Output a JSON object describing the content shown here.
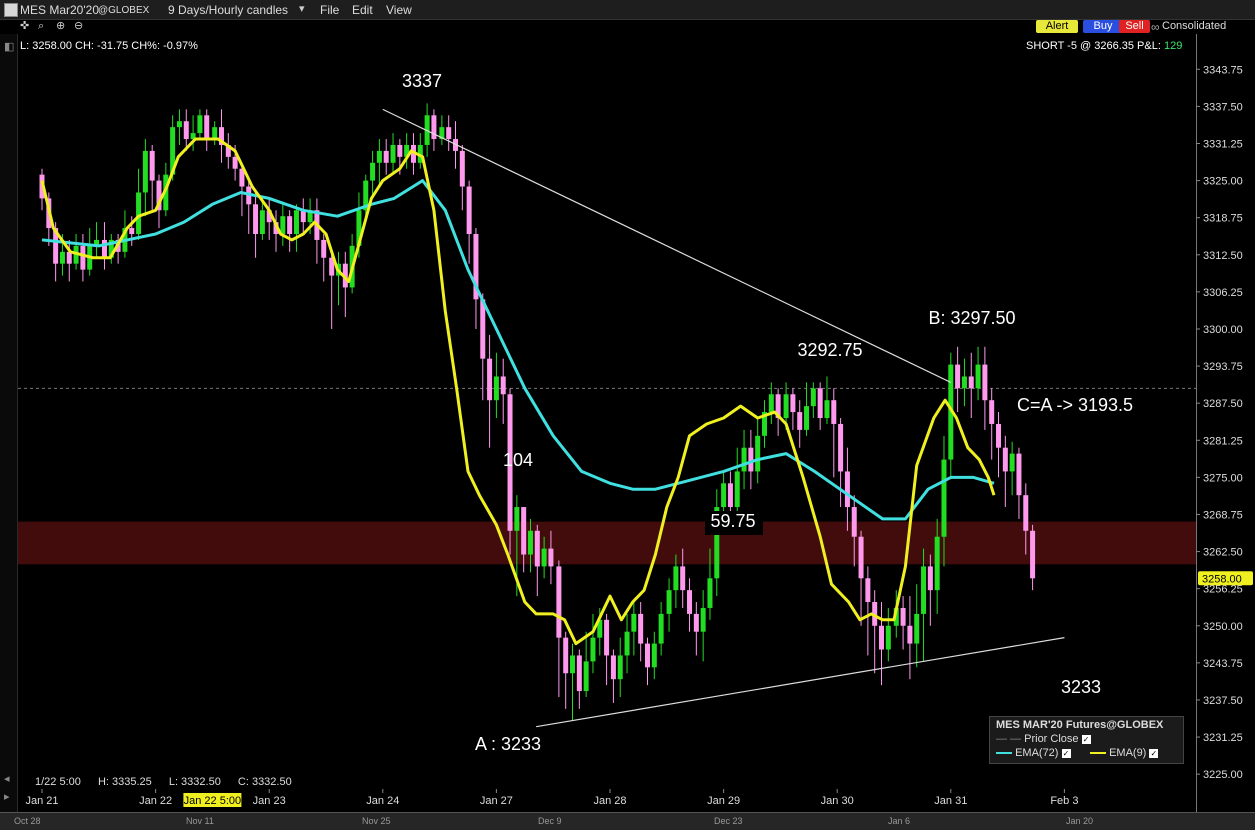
{
  "window": {
    "symbol": "MES Mar20'20",
    "exchange": "@GLOBEX",
    "timeframe": "9 Days/Hourly candles",
    "menu": [
      "File",
      "Edit",
      "View"
    ]
  },
  "toolbar": {
    "alert_label": "Alert",
    "buy_label": "Buy",
    "sell_label": "Sell",
    "consolidated_label": "Consolidated"
  },
  "info": {
    "last_line": "L: 3258.00 CH: -31.75 CH%: -0.97%",
    "position_line": "SHORT -5 @ 3266.35 P&L:",
    "pnl_value": "129"
  },
  "status": {
    "date": "1/22 5:00",
    "high": "H: 3335.25",
    "low": "L: 3332.50",
    "close": "C: 3332.50"
  },
  "legend": {
    "title": "MES MAR'20 Futures@GLOBEX",
    "prior_close": "Prior Close",
    "ema_slow": "EMA(72)",
    "ema_fast": "EMA(9)"
  },
  "overview_labels": [
    "Oct 28",
    "Nov 11",
    "Nov 25",
    "Dec 9",
    "Dec 23",
    "Jan 6",
    "Jan 20"
  ],
  "colors": {
    "up_candle": "#22dd22",
    "down_candle": "#ff99ee",
    "ema_fast": "#f0f020",
    "ema_slow": "#40e0e0",
    "price_tag": "#f0f020",
    "loss_band": "#5a1010"
  },
  "chart_data": {
    "type": "candlestick",
    "y_ticks": [
      "3343.75",
      "3337.50",
      "3331.25",
      "3325.00",
      "3318.75",
      "3312.50",
      "3306.25",
      "3300.00",
      "3293.75",
      "3287.50",
      "3281.25",
      "3275.00",
      "3268.75",
      "3262.50",
      "3256.25",
      "3250.00",
      "3243.75",
      "3237.50",
      "3231.25",
      "3225.00"
    ],
    "ylim": [
      3222.5,
      3347
    ],
    "x_labels": [
      "Jan 21",
      "Jan 22",
      "Jan 23",
      "Jan 24",
      "Jan 27",
      "Jan 28",
      "Jan 29",
      "Jan 30",
      "Jan 31",
      "Feb 3"
    ],
    "x_label_highlight": "Jan 22 5:00",
    "last_price": "3258.00",
    "prior_close": 3290,
    "position_price": 3266.35,
    "ema_labels": [
      "EMA(72)",
      "EMA(9)"
    ],
    "annotations": [
      "3337",
      "104",
      "59.75",
      "3292.75",
      "B: 3297.50",
      "C=A  -> 3193.5",
      "3233",
      "A : 3233"
    ],
    "trendlines": [
      {
        "from": [
          3.0,
          3337
        ],
        "to": [
          8.0,
          3291
        ]
      },
      {
        "from": [
          4.35,
          3233
        ],
        "to": [
          9.0,
          3248
        ]
      }
    ],
    "ema_fast": [
      [
        0.0,
        3325
      ],
      [
        0.1,
        3317
      ],
      [
        0.25,
        3313
      ],
      [
        0.45,
        3312
      ],
      [
        0.6,
        3312
      ],
      [
        0.75,
        3317
      ],
      [
        0.85,
        3319
      ],
      [
        1.0,
        3320
      ],
      [
        1.1,
        3324
      ],
      [
        1.2,
        3329
      ],
      [
        1.35,
        3332
      ],
      [
        1.55,
        3332
      ],
      [
        1.7,
        3330
      ],
      [
        1.85,
        3324
      ],
      [
        2.0,
        3320
      ],
      [
        2.1,
        3316
      ],
      [
        2.2,
        3315
      ],
      [
        2.3,
        3316
      ],
      [
        2.4,
        3318
      ],
      [
        2.5,
        3316
      ],
      [
        2.6,
        3310
      ],
      [
        2.7,
        3308
      ],
      [
        2.8,
        3315
      ],
      [
        2.9,
        3322
      ],
      [
        3.0,
        3325
      ],
      [
        3.15,
        3327
      ],
      [
        3.25,
        3330
      ],
      [
        3.35,
        3329
      ],
      [
        3.45,
        3320
      ],
      [
        3.55,
        3303
      ],
      [
        3.65,
        3290
      ],
      [
        3.75,
        3276
      ],
      [
        3.85,
        3272
      ],
      [
        4.0,
        3267
      ],
      [
        4.1,
        3262
      ],
      [
        4.25,
        3254
      ],
      [
        4.35,
        3252
      ],
      [
        4.5,
        3252
      ],
      [
        4.6,
        3251
      ],
      [
        4.7,
        3247
      ],
      [
        4.85,
        3249
      ],
      [
        5.0,
        3255
      ],
      [
        5.1,
        3251
      ],
      [
        5.2,
        3254
      ],
      [
        5.3,
        3256
      ],
      [
        5.4,
        3262
      ],
      [
        5.5,
        3270
      ],
      [
        5.6,
        3275
      ],
      [
        5.7,
        3282
      ],
      [
        5.85,
        3284
      ],
      [
        6.0,
        3285
      ],
      [
        6.15,
        3287
      ],
      [
        6.3,
        3285
      ],
      [
        6.45,
        3286
      ],
      [
        6.55,
        3284
      ],
      [
        6.7,
        3275
      ],
      [
        6.85,
        3265
      ],
      [
        6.95,
        3257
      ],
      [
        7.1,
        3254
      ],
      [
        7.2,
        3251
      ],
      [
        7.3,
        3252
      ],
      [
        7.4,
        3251
      ],
      [
        7.5,
        3251
      ],
      [
        7.6,
        3260
      ],
      [
        7.7,
        3277
      ],
      [
        7.85,
        3285
      ],
      [
        7.95,
        3288
      ],
      [
        8.05,
        3285
      ],
      [
        8.15,
        3280
      ],
      [
        8.25,
        3278
      ],
      [
        8.33,
        3275
      ],
      [
        8.38,
        3272
      ]
    ],
    "ema_slow": [
      [
        0.0,
        3315
      ],
      [
        0.5,
        3314
      ],
      [
        1.0,
        3316
      ],
      [
        1.25,
        3318
      ],
      [
        1.5,
        3321
      ],
      [
        1.75,
        3323
      ],
      [
        2.0,
        3322
      ],
      [
        2.3,
        3320
      ],
      [
        2.6,
        3319
      ],
      [
        2.9,
        3321
      ],
      [
        3.1,
        3322
      ],
      [
        3.35,
        3325
      ],
      [
        3.55,
        3320
      ],
      [
        3.75,
        3310
      ],
      [
        4.0,
        3300
      ],
      [
        4.25,
        3290
      ],
      [
        4.5,
        3282
      ],
      [
        4.75,
        3276
      ],
      [
        5.0,
        3274
      ],
      [
        5.2,
        3273
      ],
      [
        5.4,
        3273
      ],
      [
        5.6,
        3274
      ],
      [
        6.0,
        3276
      ],
      [
        6.3,
        3278
      ],
      [
        6.55,
        3279
      ],
      [
        6.8,
        3276
      ],
      [
        7.1,
        3272
      ],
      [
        7.4,
        3268
      ],
      [
        7.6,
        3268
      ],
      [
        7.8,
        3273
      ],
      [
        8.0,
        3275
      ],
      [
        8.2,
        3275
      ],
      [
        8.38,
        3274
      ]
    ],
    "candles": [
      [
        0.0,
        3326,
        3322,
        3327,
        3320
      ],
      [
        0.06,
        3322,
        3317,
        3323,
        3314
      ],
      [
        0.12,
        3317,
        3311,
        3318,
        3308
      ],
      [
        0.18,
        3311,
        3313,
        3316,
        3309
      ],
      [
        0.24,
        3313,
        3311,
        3315,
        3308
      ],
      [
        0.3,
        3311,
        3314,
        3316,
        3310
      ],
      [
        0.36,
        3314,
        3310,
        3316,
        3308
      ],
      [
        0.42,
        3310,
        3314,
        3317,
        3309
      ],
      [
        0.48,
        3314,
        3315,
        3318,
        3312
      ],
      [
        0.55,
        3315,
        3312,
        3318,
        3310
      ],
      [
        0.61,
        3312,
        3315,
        3316,
        3311
      ],
      [
        0.67,
        3315,
        3313,
        3316,
        3311
      ],
      [
        0.73,
        3313,
        3317,
        3320,
        3312
      ],
      [
        0.79,
        3317,
        3316,
        3319,
        3314
      ],
      [
        0.85,
        3316,
        3323,
        3327,
        3315
      ],
      [
        0.91,
        3323,
        3330,
        3332,
        3319
      ],
      [
        0.97,
        3330,
        3325,
        3331,
        3320
      ],
      [
        1.03,
        3325,
        3320,
        3326,
        3317
      ],
      [
        1.09,
        3320,
        3326,
        3328,
        3319
      ],
      [
        1.15,
        3326,
        3334,
        3336,
        3325
      ],
      [
        1.21,
        3334,
        3335,
        3337,
        3331
      ],
      [
        1.27,
        3335,
        3332,
        3337,
        3330
      ],
      [
        1.33,
        3332,
        3333,
        3336,
        3330
      ],
      [
        1.39,
        3333,
        3336,
        3337,
        3332
      ],
      [
        1.45,
        3336,
        3332,
        3337,
        3330
      ],
      [
        1.52,
        3332,
        3334,
        3335,
        3331
      ],
      [
        1.58,
        3334,
        3331,
        3337,
        3328
      ],
      [
        1.64,
        3331,
        3329,
        3333,
        3327
      ],
      [
        1.7,
        3329,
        3327,
        3331,
        3325
      ],
      [
        1.76,
        3327,
        3324,
        3328,
        3319
      ],
      [
        1.82,
        3324,
        3321,
        3325,
        3316
      ],
      [
        1.88,
        3321,
        3316,
        3323,
        3312
      ],
      [
        1.94,
        3316,
        3320,
        3322,
        3315
      ],
      [
        2.0,
        3320,
        3318,
        3322,
        3315
      ],
      [
        2.06,
        3318,
        3316,
        3320,
        3313
      ],
      [
        2.12,
        3316,
        3319,
        3321,
        3314
      ],
      [
        2.18,
        3319,
        3316,
        3320,
        3313
      ],
      [
        2.24,
        3316,
        3320,
        3321,
        3313
      ],
      [
        2.3,
        3320,
        3318,
        3322,
        3316
      ],
      [
        2.36,
        3318,
        3320,
        3322,
        3316
      ],
      [
        2.42,
        3320,
        3315,
        3322,
        3311
      ],
      [
        2.48,
        3315,
        3312,
        3316,
        3308
      ],
      [
        2.55,
        3312,
        3309,
        3313,
        3300
      ],
      [
        2.61,
        3309,
        3311,
        3313,
        3304
      ],
      [
        2.67,
        3311,
        3307,
        3313,
        3302
      ],
      [
        2.73,
        3307,
        3314,
        3316,
        3306
      ],
      [
        2.79,
        3314,
        3320,
        3323,
        3312
      ],
      [
        2.85,
        3320,
        3325,
        3326,
        3318
      ],
      [
        2.91,
        3325,
        3328,
        3330,
        3322
      ],
      [
        2.97,
        3328,
        3330,
        3332,
        3324
      ],
      [
        3.03,
        3330,
        3328,
        3332,
        3326
      ],
      [
        3.09,
        3328,
        3331,
        3333,
        3326
      ],
      [
        3.15,
        3331,
        3329,
        3332,
        3326
      ],
      [
        3.21,
        3329,
        3331,
        3333,
        3327
      ],
      [
        3.27,
        3331,
        3328,
        3333,
        3326
      ],
      [
        3.33,
        3328,
        3331,
        3333,
        3327
      ],
      [
        3.39,
        3331,
        3336,
        3338,
        3329
      ],
      [
        3.45,
        3336,
        3332,
        3337,
        3330
      ],
      [
        3.52,
        3332,
        3334,
        3336,
        3331
      ],
      [
        3.58,
        3334,
        3332,
        3336,
        3330
      ],
      [
        3.64,
        3332,
        3330,
        3335,
        3327
      ],
      [
        3.7,
        3330,
        3324,
        3331,
        3320
      ],
      [
        3.76,
        3324,
        3316,
        3325,
        3311
      ],
      [
        3.82,
        3316,
        3305,
        3317,
        3300
      ],
      [
        3.88,
        3305,
        3295,
        3306,
        3288
      ],
      [
        3.94,
        3295,
        3288,
        3299,
        3280
      ],
      [
        4.0,
        3288,
        3292,
        3296,
        3285
      ],
      [
        4.06,
        3292,
        3289,
        3295,
        3284
      ],
      [
        4.12,
        3289,
        3266,
        3290,
        3262
      ],
      [
        4.18,
        3266,
        3270,
        3272,
        3255
      ],
      [
        4.24,
        3270,
        3262,
        3270,
        3259
      ],
      [
        4.3,
        3262,
        3266,
        3268,
        3259
      ],
      [
        4.36,
        3266,
        3260,
        3267,
        3255
      ],
      [
        4.42,
        3260,
        3263,
        3265,
        3258
      ],
      [
        4.48,
        3263,
        3260,
        3266,
        3257
      ],
      [
        4.55,
        3260,
        3248,
        3261,
        3238
      ],
      [
        4.61,
        3248,
        3242,
        3249,
        3236
      ],
      [
        4.67,
        3242,
        3245,
        3247,
        3234
      ],
      [
        4.73,
        3245,
        3239,
        3246,
        3236
      ],
      [
        4.79,
        3239,
        3244,
        3249,
        3238
      ],
      [
        4.85,
        3244,
        3248,
        3252,
        3242
      ],
      [
        4.91,
        3248,
        3251,
        3253,
        3245
      ],
      [
        4.97,
        3251,
        3245,
        3252,
        3240
      ],
      [
        5.03,
        3245,
        3241,
        3246,
        3237
      ],
      [
        5.09,
        3241,
        3245,
        3248,
        3238
      ],
      [
        5.15,
        3245,
        3249,
        3252,
        3242
      ],
      [
        5.21,
        3249,
        3252,
        3254,
        3245
      ],
      [
        5.27,
        3252,
        3247,
        3254,
        3244
      ],
      [
        5.33,
        3247,
        3243,
        3248,
        3240
      ],
      [
        5.39,
        3243,
        3247,
        3249,
        3241
      ],
      [
        5.45,
        3247,
        3252,
        3254,
        3245
      ],
      [
        5.52,
        3252,
        3256,
        3258,
        3249
      ],
      [
        5.58,
        3256,
        3260,
        3262,
        3253
      ],
      [
        5.64,
        3260,
        3256,
        3263,
        3253
      ],
      [
        5.7,
        3256,
        3252,
        3258,
        3249
      ],
      [
        5.76,
        3252,
        3249,
        3254,
        3245
      ],
      [
        5.82,
        3249,
        3253,
        3256,
        3244
      ],
      [
        5.88,
        3253,
        3258,
        3263,
        3251
      ],
      [
        5.94,
        3258,
        3270,
        3273,
        3255
      ],
      [
        6.0,
        3270,
        3274,
        3276,
        3267
      ],
      [
        6.06,
        3274,
        3270,
        3276,
        3266
      ],
      [
        6.12,
        3270,
        3276,
        3280,
        3268
      ],
      [
        6.18,
        3276,
        3280,
        3283,
        3273
      ],
      [
        6.24,
        3280,
        3276,
        3283,
        3273
      ],
      [
        6.3,
        3276,
        3282,
        3285,
        3274
      ],
      [
        6.36,
        3282,
        3286,
        3288,
        3280
      ],
      [
        6.42,
        3286,
        3289,
        3291,
        3284
      ],
      [
        6.48,
        3289,
        3285,
        3290,
        3282
      ],
      [
        6.55,
        3285,
        3289,
        3291,
        3283
      ],
      [
        6.61,
        3289,
        3286,
        3290,
        3283
      ],
      [
        6.67,
        3286,
        3283,
        3288,
        3280
      ],
      [
        6.73,
        3283,
        3287,
        3291,
        3282
      ],
      [
        6.79,
        3287,
        3290,
        3291,
        3285
      ],
      [
        6.85,
        3290,
        3285,
        3291,
        3283
      ],
      [
        6.91,
        3285,
        3288,
        3292,
        3284
      ],
      [
        6.97,
        3288,
        3284,
        3290,
        3275
      ],
      [
        7.03,
        3284,
        3276,
        3285,
        3270
      ],
      [
        7.09,
        3276,
        3270,
        3280,
        3266
      ],
      [
        7.15,
        3270,
        3265,
        3272,
        3260
      ],
      [
        7.21,
        3265,
        3258,
        3266,
        3250
      ],
      [
        7.27,
        3258,
        3254,
        3260,
        3245
      ],
      [
        7.33,
        3254,
        3250,
        3256,
        3242
      ],
      [
        7.39,
        3250,
        3246,
        3254,
        3240
      ],
      [
        7.45,
        3246,
        3250,
        3253,
        3244
      ],
      [
        7.52,
        3250,
        3253,
        3256,
        3248
      ],
      [
        7.58,
        3253,
        3250,
        3255,
        3246
      ],
      [
        7.64,
        3250,
        3247,
        3255,
        3241
      ],
      [
        7.7,
        3247,
        3252,
        3257,
        3243
      ],
      [
        7.76,
        3252,
        3260,
        3263,
        3244
      ],
      [
        7.82,
        3260,
        3256,
        3262,
        3250
      ],
      [
        7.88,
        3256,
        3265,
        3268,
        3252
      ],
      [
        7.94,
        3265,
        3278,
        3282,
        3260
      ],
      [
        8.0,
        3278,
        3294,
        3296,
        3275
      ],
      [
        8.06,
        3294,
        3290,
        3297,
        3286
      ],
      [
        8.12,
        3290,
        3292,
        3295,
        3287
      ],
      [
        8.18,
        3292,
        3290,
        3296,
        3285
      ],
      [
        8.24,
        3290,
        3294,
        3297,
        3288
      ],
      [
        8.3,
        3294,
        3288,
        3297,
        3283
      ],
      [
        8.36,
        3288,
        3284,
        3290,
        3278
      ],
      [
        8.42,
        3284,
        3280,
        3286,
        3275
      ],
      [
        8.48,
        3280,
        3276,
        3282,
        3270
      ],
      [
        8.54,
        3276,
        3279,
        3281,
        3272
      ],
      [
        8.6,
        3279,
        3272,
        3280,
        3268
      ],
      [
        8.66,
        3272,
        3266,
        3274,
        3262
      ],
      [
        8.72,
        3266,
        3258,
        3267,
        3256
      ]
    ]
  }
}
